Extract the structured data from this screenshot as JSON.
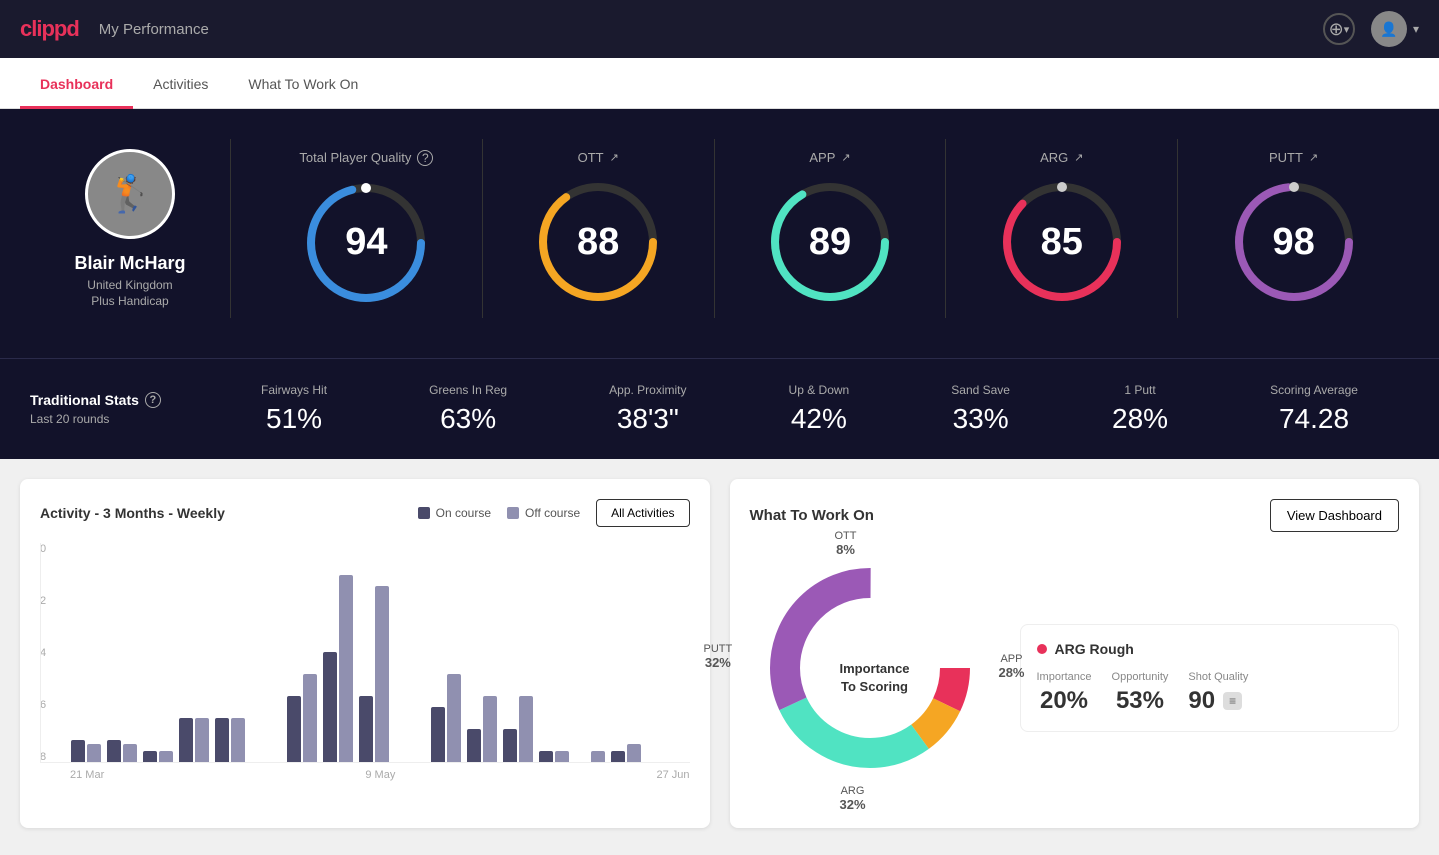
{
  "header": {
    "logo": "clippd",
    "title": "My Performance",
    "add_button_label": "+",
    "user_label": "▾"
  },
  "nav": {
    "tabs": [
      {
        "id": "dashboard",
        "label": "Dashboard",
        "active": true
      },
      {
        "id": "activities",
        "label": "Activities",
        "active": false
      },
      {
        "id": "what-to-work-on",
        "label": "What To Work On",
        "active": false
      }
    ]
  },
  "hero": {
    "player": {
      "name": "Blair McHarg",
      "location": "United Kingdom",
      "handicap": "Plus Handicap"
    },
    "scores": {
      "total_label": "Total Player Quality",
      "total_value": "94",
      "categories": [
        {
          "id": "ott",
          "label": "OTT",
          "value": "88",
          "color": "#f5a623"
        },
        {
          "id": "app",
          "label": "APP",
          "value": "89",
          "color": "#50e3c2"
        },
        {
          "id": "arg",
          "label": "ARG",
          "value": "85",
          "color": "#e8315a"
        },
        {
          "id": "putt",
          "label": "PUTT",
          "value": "98",
          "color": "#9b59b6"
        }
      ]
    }
  },
  "stats": {
    "title": "Traditional Stats",
    "subtitle": "Last 20 rounds",
    "items": [
      {
        "label": "Fairways Hit",
        "value": "51%"
      },
      {
        "label": "Greens In Reg",
        "value": "63%"
      },
      {
        "label": "App. Proximity",
        "value": "38'3\""
      },
      {
        "label": "Up & Down",
        "value": "42%"
      },
      {
        "label": "Sand Save",
        "value": "33%"
      },
      {
        "label": "1 Putt",
        "value": "28%"
      },
      {
        "label": "Scoring Average",
        "value": "74.28"
      }
    ]
  },
  "activity_chart": {
    "title": "Activity - 3 Months - Weekly",
    "legend": [
      {
        "label": "On course",
        "color": "#4a4a6a"
      },
      {
        "label": "Off course",
        "color": "#9090b0"
      }
    ],
    "all_activities_btn": "All Activities",
    "x_labels": [
      "21 Mar",
      "9 May",
      "27 Jun"
    ],
    "y_labels": [
      "0",
      "2",
      "4",
      "6",
      "8"
    ],
    "bars": [
      {
        "oncourse": 1,
        "offcourse": 0.8
      },
      {
        "oncourse": 1,
        "offcourse": 0.8
      },
      {
        "oncourse": 0.5,
        "offcourse": 0.5
      },
      {
        "oncourse": 2,
        "offcourse": 2
      },
      {
        "oncourse": 2,
        "offcourse": 2
      },
      {
        "oncourse": 0,
        "offcourse": 0
      },
      {
        "oncourse": 3,
        "offcourse": 4
      },
      {
        "oncourse": 5,
        "offcourse": 8.5
      },
      {
        "oncourse": 3,
        "offcourse": 8
      },
      {
        "oncourse": 0,
        "offcourse": 0
      },
      {
        "oncourse": 2.5,
        "offcourse": 4
      },
      {
        "oncourse": 1.5,
        "offcourse": 3
      },
      {
        "oncourse": 1.5,
        "offcourse": 3
      },
      {
        "oncourse": 0.5,
        "offcourse": 0.5
      },
      {
        "oncourse": 0,
        "offcourse": 0.5
      },
      {
        "oncourse": 0.5,
        "offcourse": 0.8
      }
    ]
  },
  "what_to_work_on": {
    "title": "What To Work On",
    "view_dashboard_btn": "View Dashboard",
    "donut_center": "Importance\nTo Scoring",
    "segments": [
      {
        "id": "ott",
        "label": "OTT",
        "pct": "8%",
        "color": "#f5a623"
      },
      {
        "id": "app",
        "label": "APP",
        "pct": "28%",
        "color": "#50e3c2"
      },
      {
        "id": "arg",
        "label": "ARG",
        "pct": "32%",
        "color": "#e8315a"
      },
      {
        "id": "putt",
        "label": "PUTT",
        "pct": "32%",
        "color": "#9b59b6"
      }
    ],
    "info_card": {
      "title": "ARG Rough",
      "color": "#e8315a",
      "metrics": [
        {
          "label": "Importance",
          "value": "20%"
        },
        {
          "label": "Opportunity",
          "value": "53%"
        },
        {
          "label": "Shot Quality",
          "value": "90"
        }
      ]
    }
  }
}
